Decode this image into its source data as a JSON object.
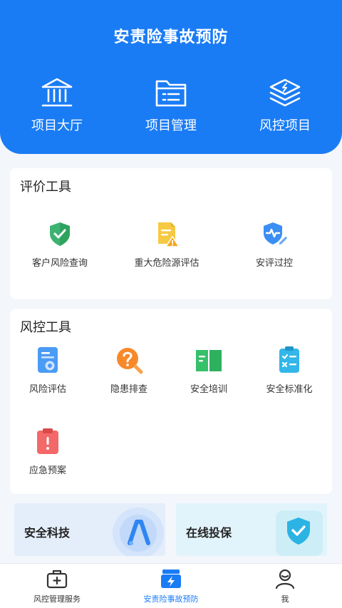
{
  "header": {
    "title": "安责险事故预防",
    "nav": [
      {
        "label": "项目大厅",
        "icon": "bank-icon"
      },
      {
        "label": "项目管理",
        "icon": "folder-list-icon"
      },
      {
        "label": "风控项目",
        "icon": "layers-icon"
      }
    ]
  },
  "eval_tools": {
    "title": "评价工具",
    "items": [
      {
        "label": "客户风险查询",
        "icon": "shield-check-icon"
      },
      {
        "label": "重大危险源评估",
        "icon": "document-warning-icon"
      },
      {
        "label": "安评过控",
        "icon": "shield-pulse-icon"
      }
    ]
  },
  "risk_tools": {
    "title": "风控工具",
    "items": [
      {
        "label": "风险评估",
        "icon": "risk-doc-icon"
      },
      {
        "label": "隐患排查",
        "icon": "question-search-icon"
      },
      {
        "label": "安全培训",
        "icon": "open-book-icon"
      },
      {
        "label": "安全标准化",
        "icon": "checklist-icon"
      },
      {
        "label": "应急预案",
        "icon": "clipboard-alert-icon"
      }
    ]
  },
  "banners": [
    {
      "label": "安全科技",
      "icon": "tech-logo-icon"
    },
    {
      "label": "在线投保",
      "icon": "shield-check-icon"
    }
  ],
  "tabbar": {
    "items": [
      {
        "label": "风控管理服务",
        "icon": "medkit-icon",
        "active": false
      },
      {
        "label": "安责险事故预防",
        "icon": "bolt-card-icon",
        "active": true
      },
      {
        "label": "我",
        "icon": "user-icon",
        "active": false
      }
    ]
  },
  "colors": {
    "primary": "#1a7cf5",
    "background": "#f3f6fb",
    "card": "#ffffff"
  }
}
